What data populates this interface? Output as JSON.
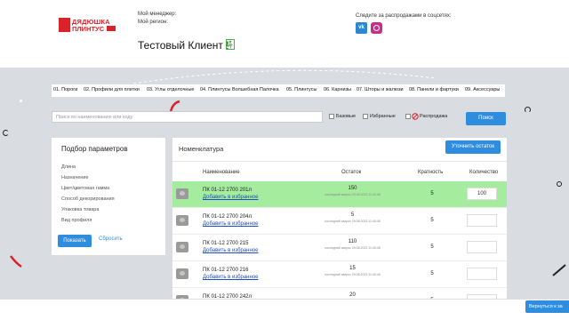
{
  "header": {
    "logo_line1": "ДЯДЮШКА",
    "logo_line2": "ПЛИНТУС",
    "manager_label": "Мой менеджер:",
    "region_label": "Мой регион:",
    "client_name": "Тестовый Клиент !",
    "social_label": "Следите за распродажами в соцсетях:",
    "vk_text": "vk"
  },
  "categories": [
    "01. Пороги",
    "02. Профили для плитки",
    "03. Углы отделочные",
    "04. Плинтусы Волшебная Палочка",
    "05. Плинтусы",
    "06. Карнизы",
    "07. Шторы и жалюзи",
    "08. Панели и фартуки",
    "09. Аксессуары"
  ],
  "search": {
    "placeholder": "Поиск по наименованию или коду",
    "checkbox_basic": "Базовые",
    "checkbox_favorites": "Избранные",
    "checkbox_sale": "Распродажа",
    "button": "Поиск"
  },
  "filters": {
    "title": "Подбор параметров",
    "items": [
      "Длина",
      "Назначение",
      "Цвет/цветовая гамма",
      "Способ декорирования",
      "Упаковка товара",
      "Вид профиля"
    ],
    "show_button": "Показать",
    "reset_link": "Сбросить"
  },
  "nomenclature": {
    "title": "Номенклатура",
    "calc_button": "Уточнить остаток",
    "columns": [
      "Наименование",
      "Остаток",
      "Кратность",
      "Количество"
    ],
    "fav_label": "Добавить в избранное",
    "stock_sub": "последний запрос 29.08.2023 11:40:48",
    "rows": [
      {
        "name": "ПК 01-12 2700 201л",
        "stock": "150",
        "multiplicity": "5",
        "qty": "100"
      },
      {
        "name": "ПК 01-12 2700 204л",
        "stock": "5",
        "multiplicity": "5",
        "qty": ""
      },
      {
        "name": "ПК 01-12 2700 215",
        "stock": "110",
        "multiplicity": "5",
        "qty": ""
      },
      {
        "name": "ПК 01-12 2700 216",
        "stock": "15",
        "multiplicity": "5",
        "qty": ""
      },
      {
        "name": "ПК 01-12 2700 242л",
        "stock": "20",
        "multiplicity": "5",
        "qty": ""
      }
    ]
  },
  "footer": {
    "back_button": "Вернуться к за"
  },
  "colors": {
    "accent": "#2f8de0",
    "brand": "#d8232a",
    "highlight_row": "#a6ec9f",
    "background": "#d9dde1"
  }
}
